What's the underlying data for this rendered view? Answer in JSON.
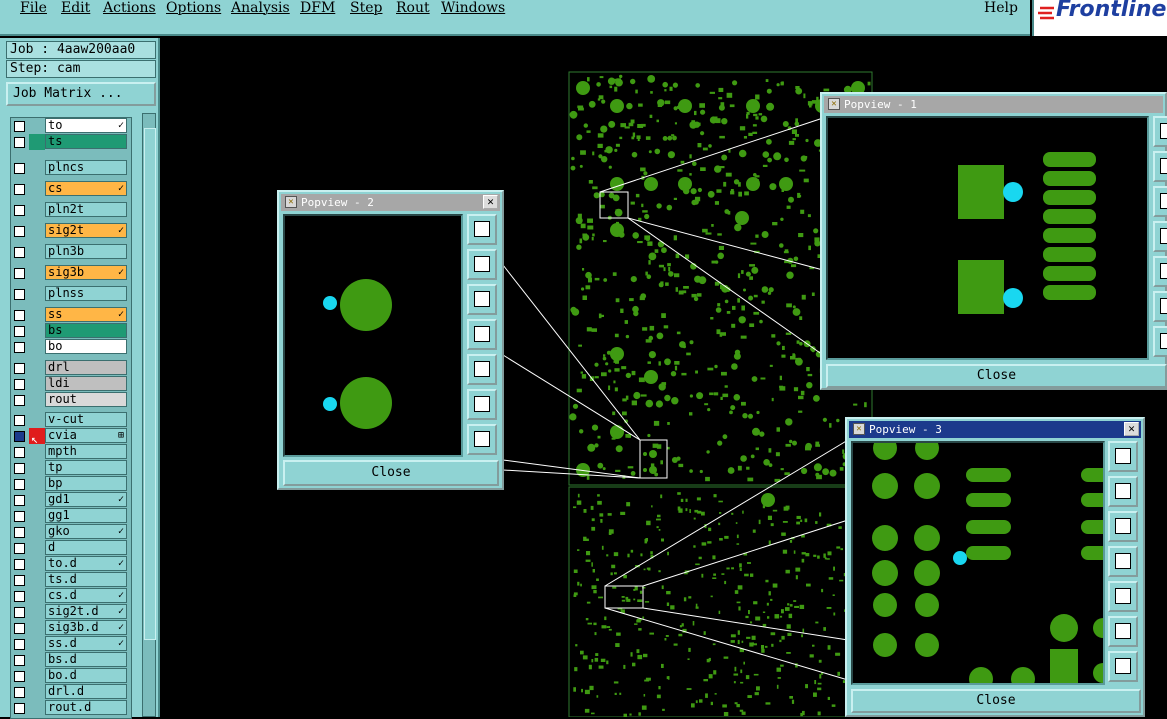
{
  "menu": {
    "file": "File",
    "edit": "Edit",
    "actions": "Actions",
    "options": "Options",
    "analysis": "Analysis",
    "dfm": "DFM",
    "step": "Step",
    "rout": "Rout",
    "windows": "Windows",
    "help": "Help"
  },
  "logo": "Frontline",
  "job": {
    "job_line": "Job : 4aaw200aa0",
    "step_line": "Step: cam",
    "matrix_button": "Job Matrix ..."
  },
  "layers": [
    {
      "name": "to",
      "color": "#ffffff",
      "mark": "✓"
    },
    {
      "name": "ts",
      "color": "#1f9a74",
      "mark": ""
    },
    {
      "name": "plncs",
      "color": "#8fd3d3",
      "mark": ""
    },
    {
      "name": "cs",
      "color": "#ffb646",
      "mark": "✓"
    },
    {
      "name": "pln2t",
      "color": "#8fd3d3",
      "mark": ""
    },
    {
      "name": "sig2t",
      "color": "#ffb646",
      "mark": "✓"
    },
    {
      "name": "pln3b",
      "color": "#8fd3d3",
      "mark": ""
    },
    {
      "name": "sig3b",
      "color": "#ffb646",
      "mark": "✓"
    },
    {
      "name": "plnss",
      "color": "#8fd3d3",
      "mark": ""
    },
    {
      "name": "ss",
      "color": "#ffb646",
      "mark": "✓"
    },
    {
      "name": "bs",
      "color": "#1f9a74",
      "mark": ""
    },
    {
      "name": "bo",
      "color": "#ffffff",
      "mark": ""
    },
    {
      "name": "drl",
      "color": "#bfbfbf",
      "mark": ""
    },
    {
      "name": "ldi",
      "color": "#bfbfbf",
      "mark": ""
    },
    {
      "name": "rout",
      "color": "#d9d9d9",
      "mark": ""
    },
    {
      "name": "v-cut",
      "color": "#8fd3d3",
      "mark": ""
    },
    {
      "name": "cvia",
      "color": "#8fd3d3",
      "mark": "⊞"
    },
    {
      "name": "mpth",
      "color": "#8fd3d3",
      "mark": ""
    },
    {
      "name": "tp",
      "color": "#8fd3d3",
      "mark": ""
    },
    {
      "name": "bp",
      "color": "#8fd3d3",
      "mark": ""
    },
    {
      "name": "gd1",
      "color": "#8fd3d3",
      "mark": "✓"
    },
    {
      "name": "gg1",
      "color": "#8fd3d3",
      "mark": ""
    },
    {
      "name": "gko",
      "color": "#8fd3d3",
      "mark": "✓"
    },
    {
      "name": "d",
      "color": "#8fd3d3",
      "mark": ""
    },
    {
      "name": "to.d",
      "color": "#8fd3d3",
      "mark": "✓"
    },
    {
      "name": "ts.d",
      "color": "#8fd3d3",
      "mark": ""
    },
    {
      "name": "cs.d",
      "color": "#8fd3d3",
      "mark": "✓"
    },
    {
      "name": "sig2t.d",
      "color": "#8fd3d3",
      "mark": "✓"
    },
    {
      "name": "sig3b.d",
      "color": "#8fd3d3",
      "mark": "✓"
    },
    {
      "name": "ss.d",
      "color": "#8fd3d3",
      "mark": "✓"
    },
    {
      "name": "bs.d",
      "color": "#8fd3d3",
      "mark": ""
    },
    {
      "name": "bo.d",
      "color": "#8fd3d3",
      "mark": ""
    },
    {
      "name": "drl.d",
      "color": "#8fd3d3",
      "mark": ""
    },
    {
      "name": "rout.d",
      "color": "#8fd3d3",
      "mark": ""
    }
  ],
  "popview1": {
    "title": "Popview - 1",
    "close_label": "Close"
  },
  "popview2": {
    "title": "Popview - 2",
    "close_label": "Close"
  },
  "popview3": {
    "title": "Popview - 3",
    "close_label": "Close"
  },
  "colors": {
    "pad": "#3f9a12",
    "via_highlight": "#19d7f0",
    "panel": "#8fd3d3",
    "board_bg": "#000000"
  }
}
